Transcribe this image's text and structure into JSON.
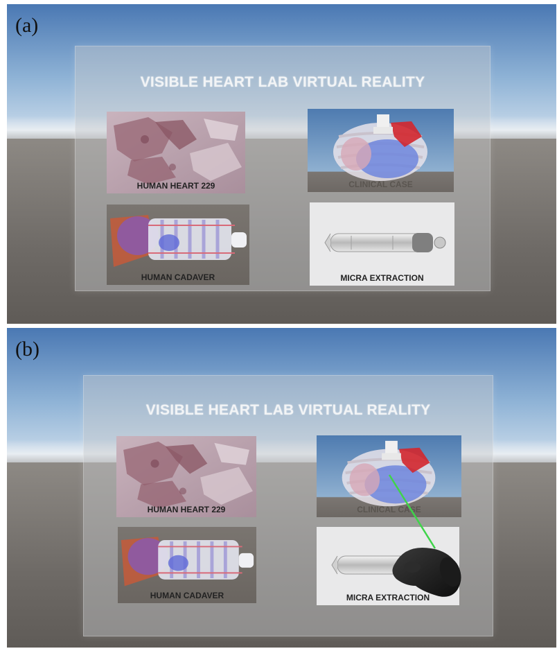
{
  "scenes": [
    {
      "label": "(a)",
      "title": "VISIBLE HEART LAB VIRTUAL REALITY",
      "tiles": [
        {
          "label": "HUMAN HEART 229"
        },
        {
          "label": "CLINICAL CASE"
        },
        {
          "label": "HUMAN CADAVER"
        },
        {
          "label": "MICRA EXTRACTION"
        }
      ]
    },
    {
      "label": "(b)",
      "title": "VISIBLE HEART LAB VIRTUAL REALITY",
      "tiles": [
        {
          "label": "HUMAN HEART 229"
        },
        {
          "label": "CLINICAL CASE"
        },
        {
          "label": "HUMAN CADAVER"
        },
        {
          "label": "MICRA EXTRACTION"
        }
      ],
      "pointer_target": "CLINICAL CASE"
    }
  ],
  "colors": {
    "laser": "#3fd44a",
    "controller": "#1a1a1a"
  }
}
